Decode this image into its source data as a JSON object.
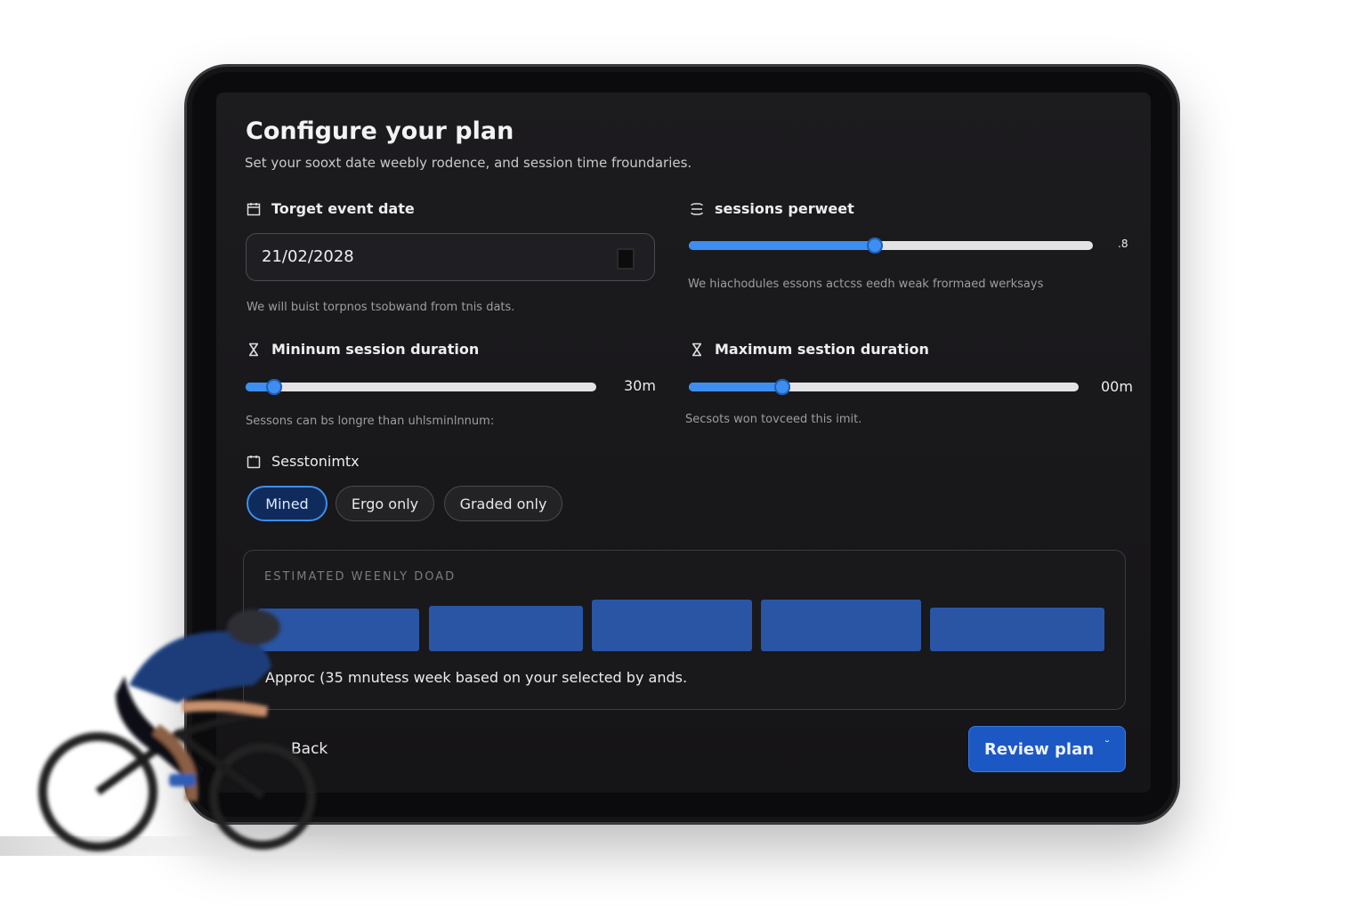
{
  "header": {
    "title": "Configure your plan",
    "subtitle": "Set your sooxt date  weebly rodence, and session time froundaries."
  },
  "event_date": {
    "label": "Torget event date",
    "value": "21/02/2028",
    "help": "We will buist torpnos tsobwand from tnis dats."
  },
  "sessions_per_week": {
    "label": "sessions perweet",
    "value_label": ".8",
    "slider_fraction": 0.46,
    "help": "We hiachodules essons actcss eedh weak frormaed werksays"
  },
  "min_duration": {
    "label": "Mininum session duration",
    "value_label": "30m",
    "slider_fraction": 0.08,
    "help": "Sessons can bs longre than uhlsminlnnum:"
  },
  "max_duration": {
    "label": "Maximum sestion duration",
    "value_label": "00m",
    "slider_fraction": 0.24,
    "help": "Secsots won tovceed this imit."
  },
  "session_mix": {
    "label": "Sesstonimtx",
    "options": [
      "Mined",
      "Ergo only",
      "Graded only"
    ],
    "selected": "Mined"
  },
  "weekly_load": {
    "title": "ESTIMATED  WEENLY DOAD",
    "summary": "Approc (35 mnutess week based on your selected by ands."
  },
  "footer": {
    "back_label": "Back",
    "review_label": "Review plan",
    "review_icon": "˘"
  },
  "colors": {
    "accent": "#3d8ef0",
    "primary_button": "#1c58c4",
    "chip_active": "#0f2b5c",
    "bar": "#2a55a4"
  }
}
